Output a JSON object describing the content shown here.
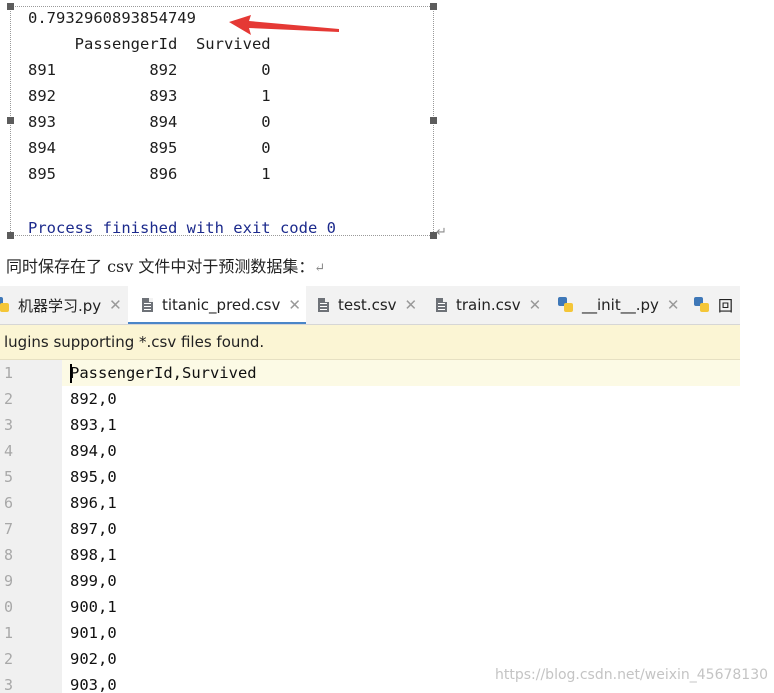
{
  "console": {
    "score": "0.7932960893854749",
    "header": "     PassengerId  Survived",
    "rows": [
      "891          892         0",
      "892          893         1",
      "893          894         0",
      "894          895         0",
      "895          896         1"
    ],
    "finish": "Process finished with exit code 0",
    "arrow_color": "#e53935"
  },
  "caption": "同时保存在了 csv 文件中对于预测数据集：",
  "ide": {
    "tabs": [
      {
        "label": "机器学习.py",
        "icon": "python-icon"
      },
      {
        "label": "titanic_pred.csv",
        "icon": "text-file-icon"
      },
      {
        "label": "test.csv",
        "icon": "text-file-icon"
      },
      {
        "label": "train.csv",
        "icon": "text-file-icon"
      },
      {
        "label": "__init__.py",
        "icon": "python-icon"
      },
      {
        "label": "回",
        "icon": "python-icon"
      }
    ],
    "active_tab": "titanic_pred.csv",
    "banner": "lugins supporting *.csv files found.",
    "line_numbers": [
      "1",
      "2",
      "3",
      "4",
      "5",
      "6",
      "7",
      "8",
      "9",
      "0",
      "1",
      "2",
      "3"
    ],
    "lines": [
      "PassengerId,Survived",
      "892,0",
      "893,1",
      "894,0",
      "895,0",
      "896,1",
      "897,0",
      "898,1",
      "899,0",
      "900,1",
      "901,0",
      "902,0",
      "903,0"
    ],
    "accent_color": "#4a86c8",
    "banner_color": "#fbf5d4"
  },
  "watermark": "https://blog.csdn.net/weixin_45678130"
}
